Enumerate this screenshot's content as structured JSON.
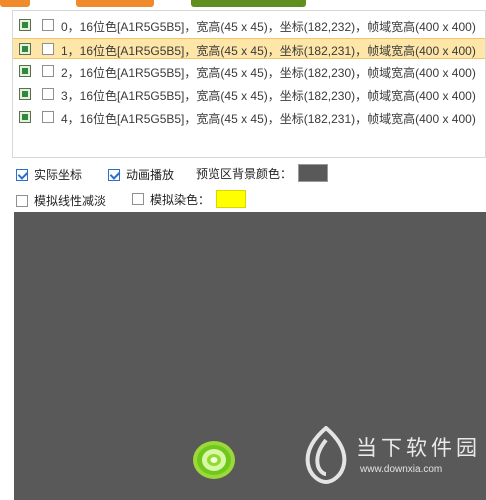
{
  "frames": [
    {
      "text": "0，16位色[A1R5G5B5]，宽高(45 x 45)，坐标(182,232)，帧域宽高(400 x 400)"
    },
    {
      "text": "1，16位色[A1R5G5B5]，宽高(45 x 45)，坐标(182,231)，帧域宽高(400 x 400)"
    },
    {
      "text": "2，16位色[A1R5G5B5]，宽高(45 x 45)，坐标(182,230)，帧域宽高(400 x 400)"
    },
    {
      "text": "3，16位色[A1R5G5B5]，宽高(45 x 45)，坐标(182,230)，帧域宽高(400 x 400)"
    },
    {
      "text": "4，16位色[A1R5G5B5]，宽高(45 x 45)，坐标(182,231)，帧域宽高(400 x 400)"
    }
  ],
  "options": {
    "actual_coords": "实际坐标",
    "animate": "动画播放",
    "bg_color_label": "预览区背景颜色：",
    "linear_fade": "模拟线性减淡",
    "tint_label": "模拟染色："
  },
  "colors": {
    "preview_background": "#595959",
    "bg_swatch": "#595959",
    "tint_swatch": "#ffff00",
    "selected_row": "#fde6a8"
  },
  "watermark": {
    "text": "当下软件园",
    "url": "www.downxia.com"
  }
}
